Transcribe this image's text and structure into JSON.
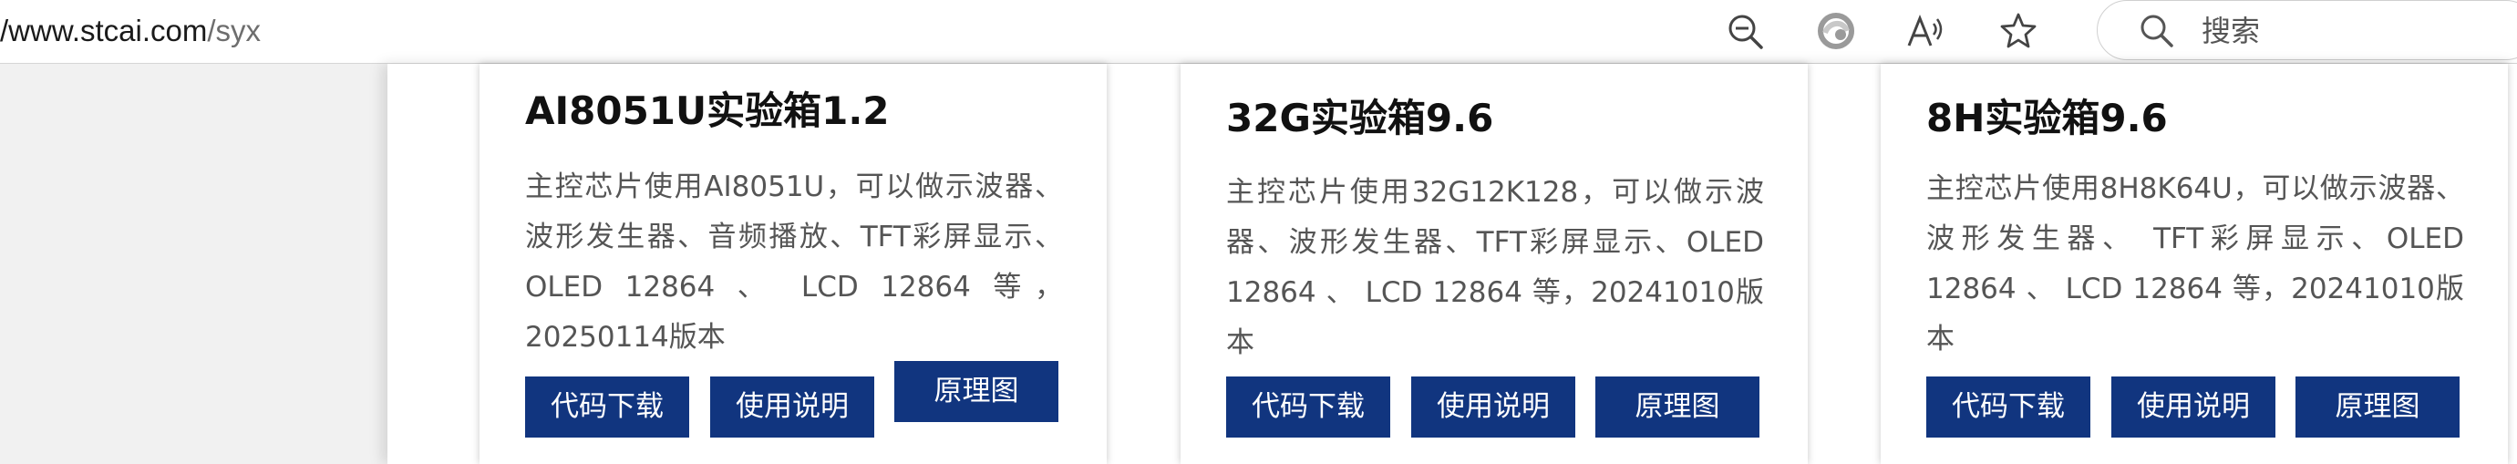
{
  "browser": {
    "url_host": "/www.stcai.com",
    "url_path": "/syx",
    "search": {
      "placeholder": "搜索"
    },
    "icons": [
      "zoom-out-icon",
      "edge-refresh-icon",
      "read-aloud-icon",
      "favorite-star-icon",
      "search-icon"
    ]
  },
  "cards": [
    {
      "title": "AI8051U实验箱1.2",
      "description": "主控芯片使用AI8051U，可以做示波器、波形发生器、音频播放、TFT彩屏显示、OLED 12864 、 LCD 12864 等，20250114版本",
      "buttons": {
        "code": "代码下载",
        "manual": "使用说明",
        "schematic": "原理图"
      }
    },
    {
      "title": "32G实验箱9.6",
      "description": "主控芯片使用32G12K128，可以做示波器、波形发生器、TFT彩屏显示、OLED 12864 、 LCD 12864 等，20241010版本",
      "buttons": {
        "code": "代码下载",
        "manual": "使用说明",
        "schematic": "原理图"
      }
    },
    {
      "title": "8H实验箱9.6",
      "description": "主控芯片使用8H8K64U，可以做示波器、波形发生器、 TFT彩屏显示、OLED 12864 、 LCD 12864 等，20241010版本",
      "buttons": {
        "code": "代码下载",
        "manual": "使用说明",
        "schematic": "原理图"
      }
    }
  ],
  "colors": {
    "button_bg": "#11357f",
    "button_text": "#ffffff",
    "title": "#111111",
    "description": "#555555"
  }
}
